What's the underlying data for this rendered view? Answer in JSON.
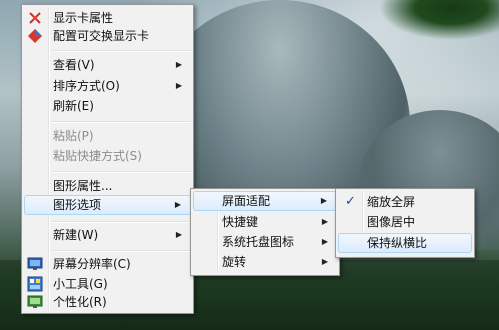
{
  "context_menu": {
    "items": [
      {
        "label": "显示卡属性"
      },
      {
        "label": "配置可交换显示卡"
      },
      {
        "label": "查看(V)"
      },
      {
        "label": "排序方式(O)"
      },
      {
        "label": "刷新(E)"
      },
      {
        "label": "粘贴(P)"
      },
      {
        "label": "粘贴快捷方式(S)"
      },
      {
        "label": "图形属性..."
      },
      {
        "label": "图形选项"
      },
      {
        "label": "新建(W)"
      },
      {
        "label": "屏幕分辨率(C)"
      },
      {
        "label": "小工具(G)"
      },
      {
        "label": "个性化(R)"
      }
    ]
  },
  "graphics_submenu": {
    "items": [
      {
        "label": "屏面适配"
      },
      {
        "label": "快捷键"
      },
      {
        "label": "系统托盘图标"
      },
      {
        "label": "旋转"
      }
    ]
  },
  "panel_fit_submenu": {
    "items": [
      {
        "label": "缩放全屏"
      },
      {
        "label": "图像居中"
      },
      {
        "label": "保持纵横比"
      }
    ],
    "check_mark": "✓"
  },
  "colors": {
    "highlight_border": "#a8d8f3",
    "menu_bg": "#f1f1f1"
  }
}
